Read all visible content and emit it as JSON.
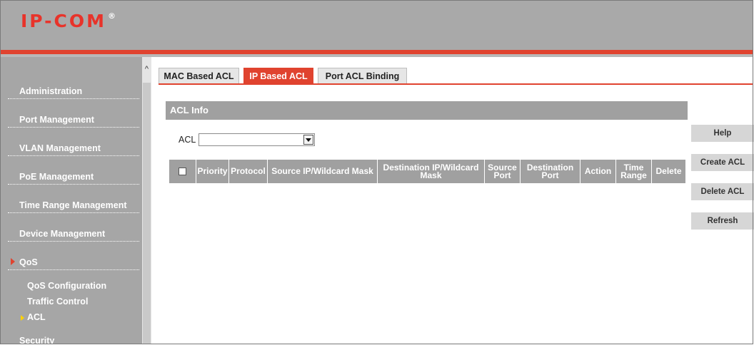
{
  "header": {
    "logo_text": "IP-COM",
    "logo_mark": "®"
  },
  "sidebar": {
    "items": [
      {
        "label": "Administration"
      },
      {
        "label": "Port Management"
      },
      {
        "label": "VLAN Management"
      },
      {
        "label": "PoE Management"
      },
      {
        "label": "Time Range Management"
      },
      {
        "label": "Device Management"
      },
      {
        "label": "QoS"
      }
    ],
    "qos_subitems": [
      {
        "label": "QoS Configuration"
      },
      {
        "label": "Traffic Control"
      },
      {
        "label": "ACL"
      }
    ],
    "security_label": "Security"
  },
  "tabs": [
    {
      "label": "MAC Based ACL",
      "active": false
    },
    {
      "label": "IP Based ACL",
      "active": true
    },
    {
      "label": "Port ACL Binding",
      "active": false
    }
  ],
  "section": {
    "title": "ACL Info"
  },
  "acl_field": {
    "label": "ACL",
    "value": ""
  },
  "table": {
    "columns": [
      "Priority",
      "Protocol",
      "Source IP/Wildcard Mask",
      "Destination IP/Wildcard Mask",
      "Source Port",
      "Destination Port",
      "Action",
      "Time Range",
      "Delete"
    ],
    "rows": []
  },
  "buttons": {
    "help": "Help",
    "create": "Create ACL",
    "delete": "Delete ACL",
    "refresh": "Refresh"
  },
  "colors": {
    "accent": "#e0432f",
    "sidebar": "#a6a6a6",
    "header": "#a9a9a9"
  }
}
